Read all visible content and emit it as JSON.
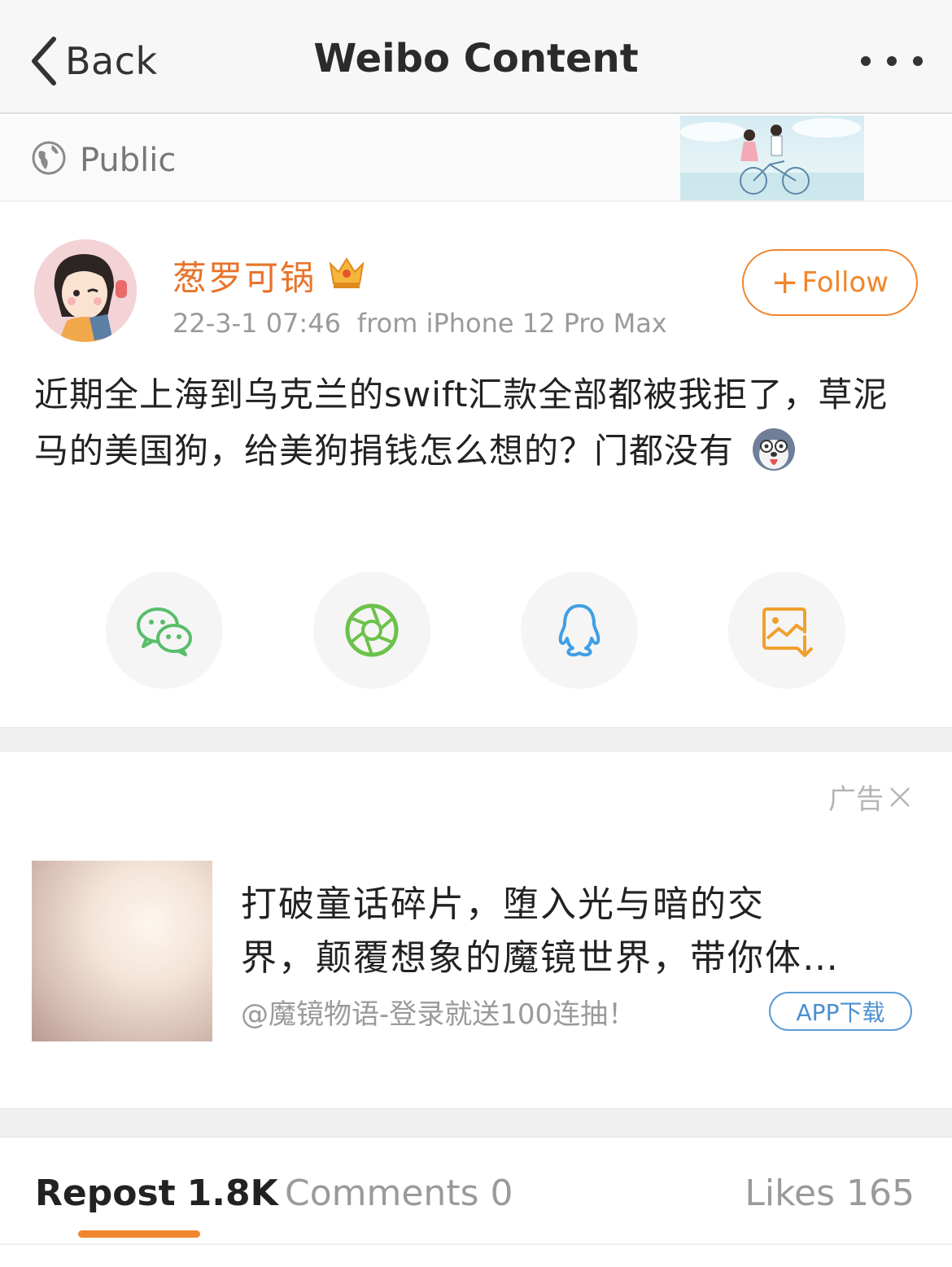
{
  "navbar": {
    "back_label": "Back",
    "title": "Weibo Content",
    "more_icon": "more-dots-icon"
  },
  "visibility": {
    "icon": "globe-icon",
    "label": "Public"
  },
  "post": {
    "username": "葱罗可锅",
    "badge_icon": "crown-icon",
    "timestamp": "22-3-1 07:46",
    "source": "from iPhone 12 Pro Max",
    "follow_label": "Follow",
    "text": "近期全上海到乌克兰的swift汇款全部都被我拒了，草泥马的美国狗，给美狗捐钱怎么想的？门都没有",
    "emoji_icon": "husky-emoji-icon"
  },
  "share": [
    {
      "name": "wechat-icon",
      "color": "#57be6a"
    },
    {
      "name": "moments-icon",
      "color": "#6cc24a"
    },
    {
      "name": "qq-icon",
      "color": "#3f9fe4"
    },
    {
      "name": "save-image-icon",
      "color": "#f0a02d"
    }
  ],
  "ad": {
    "tag": "广告",
    "line1": "打破童话碎片，堕入光与暗的交",
    "line2": "界，颠覆想象的魔镜世界，带你体…",
    "sub": "@魔镜物语-登录就送100连抽！",
    "button": "APP下载"
  },
  "tabs": {
    "repost_label": "Repost",
    "repost_count": "1.8K",
    "comments_label": "Comments",
    "comments_count": "0",
    "likes_label": "Likes",
    "likes_count": "165"
  },
  "colors": {
    "accent": "#f0862d",
    "username": "#e8732b",
    "link": "#4a8fd0"
  }
}
